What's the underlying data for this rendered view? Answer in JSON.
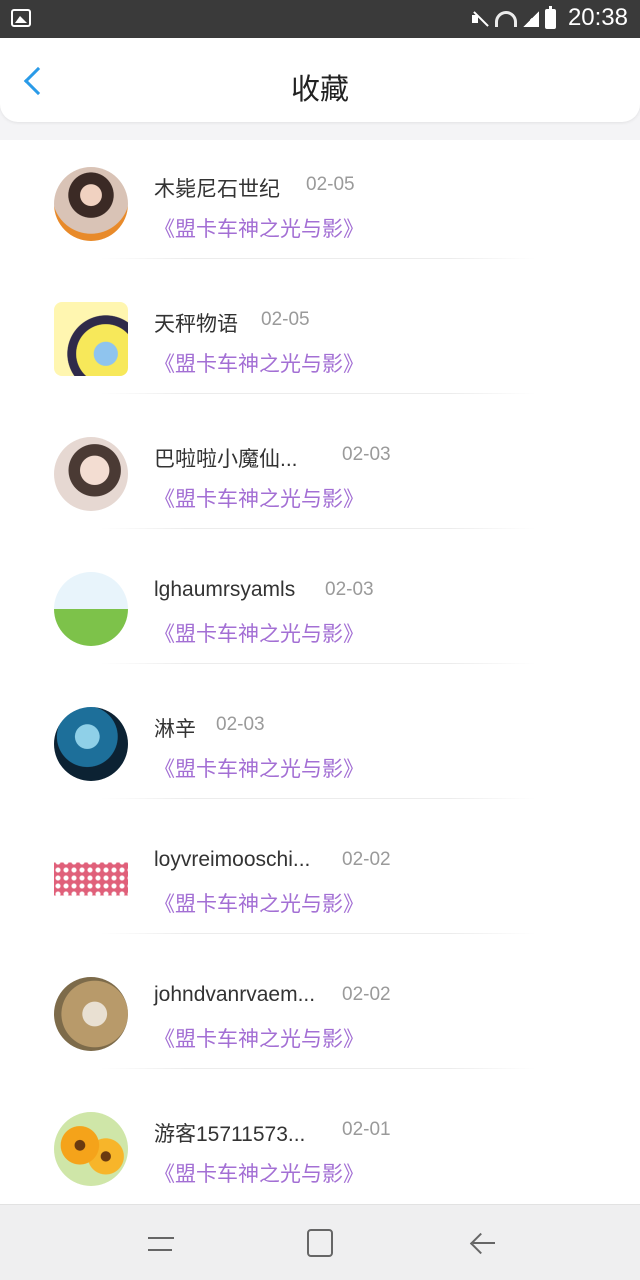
{
  "status_bar": {
    "time": "20:38"
  },
  "header": {
    "title": "收藏"
  },
  "items": [
    {
      "username": "木毙尼石世纪",
      "date": "02-05",
      "title": "《盟卡车神之光与影》",
      "avatar": "avatar-girl-photo"
    },
    {
      "username": "天秤物语",
      "date": "02-05",
      "title": "《盟卡车神之光与影》",
      "avatar": "avatar-libra-anime"
    },
    {
      "username": "巴啦啦小魔仙...",
      "date": "02-03",
      "title": "《盟卡车神之光与影》",
      "avatar": "avatar-woman-photo"
    },
    {
      "username": "lghaumrsyamls",
      "date": "02-03",
      "title": "《盟卡车神之光与影》",
      "avatar": "avatar-cartoon-field"
    },
    {
      "username": "淋辛",
      "date": "02-03",
      "title": "《盟卡车神之光与影》",
      "avatar": "avatar-blue-anime-girl"
    },
    {
      "username": "loyvreimooschi...",
      "date": "02-02",
      "title": "《盟卡车神之光与影》",
      "avatar": "avatar-pink-polka-garment"
    },
    {
      "username": "johndvanrvaem...",
      "date": "02-02",
      "title": "《盟卡车神之光与影》",
      "avatar": "avatar-alpaca"
    },
    {
      "username": "游客15711573...",
      "date": "02-01",
      "title": "《盟卡车神之光与影》",
      "avatar": "avatar-sunflowers"
    }
  ],
  "icons": {
    "back": "chevron-left-icon",
    "nav_recent": "recent-apps-icon",
    "nav_home": "home-icon",
    "nav_back": "back-arrow-icon"
  },
  "colors": {
    "accent": "#2a9be8",
    "title_purple": "#a36fd4"
  }
}
